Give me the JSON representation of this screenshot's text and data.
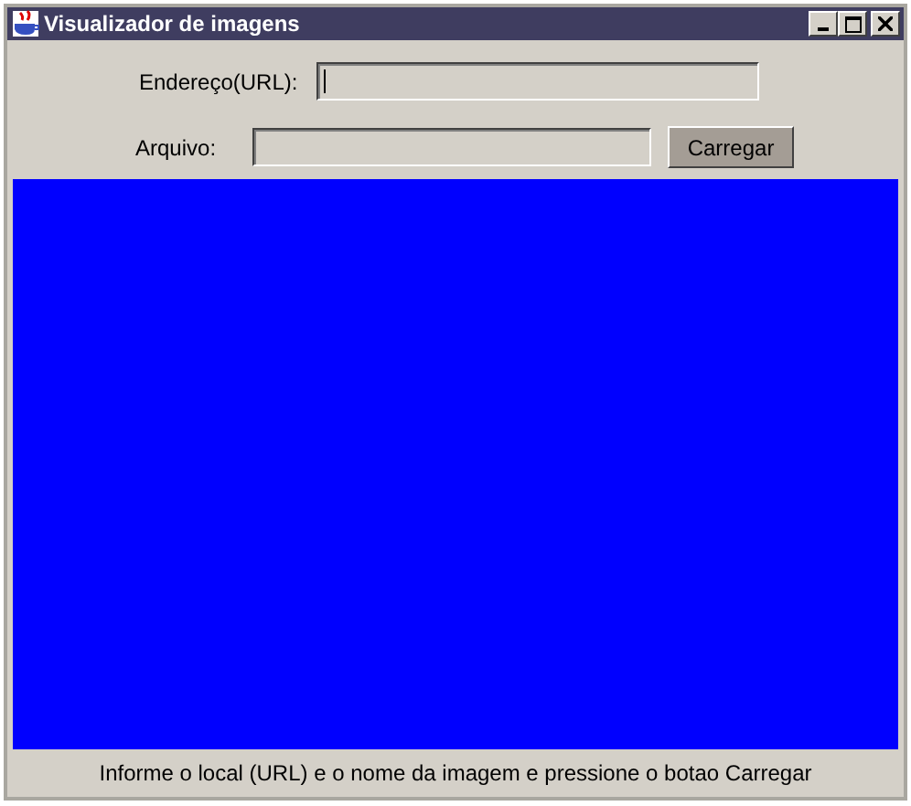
{
  "window": {
    "title": "Visualizador de imagens"
  },
  "url_field": {
    "label": "Endereço(URL):",
    "focused": true
  },
  "file_field": {
    "label": "Arquivo:",
    "focused": false
  },
  "load_button": {
    "label": "Carregar"
  },
  "status_bar": {
    "text": "Informe o local (URL) e o nome da imagem e pressione o botao Carregar"
  }
}
